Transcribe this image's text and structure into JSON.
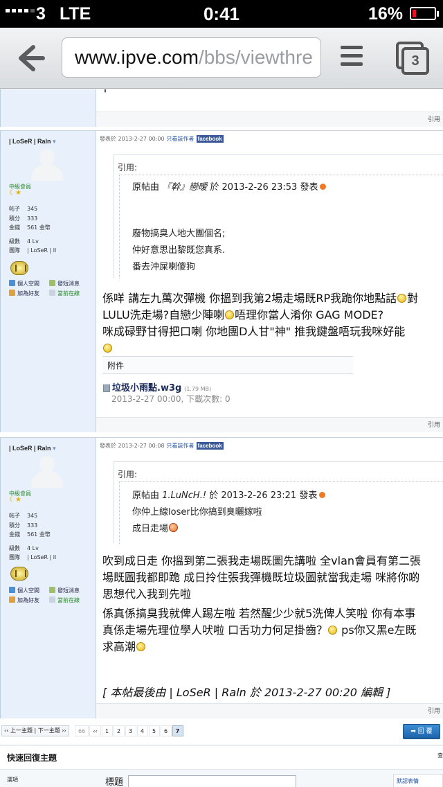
{
  "status_bar": {
    "carrier": "3",
    "network": "LTE",
    "time": "0:41",
    "battery_percent": "16%",
    "battery_level": 0.16
  },
  "browser": {
    "url_host": "www.ipve.com",
    "url_path": "/bbs/viewthre",
    "tab_count": "3",
    "back_icon": "back-arrow-icon",
    "menu_icon": "hamburger-menu-icon",
    "tabs_icon": "tabs-icon"
  },
  "top_post": {
    "quote_line": "┃",
    "reply_label": "引用"
  },
  "posts": [
    {
      "author": "| LoSeR | Raln",
      "group": "中級會員",
      "stats": [
        {
          "key": "帖子",
          "value": "345"
        },
        {
          "key": "積分",
          "value": "333"
        },
        {
          "key": "金錢",
          "value": "561 金幣"
        },
        {
          "key": "級數",
          "value": "4 Lv"
        },
        {
          "key": "團隊",
          "value": "| LoSeR | ll"
        }
      ],
      "links": {
        "space": "個人空間",
        "message": "發短消息",
        "add_friend": "加為好友",
        "online": "當前在線"
      },
      "posted_at": "發表於 2013-2-27 00:00",
      "only_author": "只看該作者",
      "facebook": "facebook",
      "quote": {
        "title": "引用:",
        "header_prefix": "原帖由",
        "quoted_author": "『幹』戀暧",
        "header_suffix": "於 2013-2-26 23:53 發表",
        "lines": [
          "廢物搞臭人地大團個名;",
          "仲好意思出黎既您真系.",
          "番去沖屎喇傻狗"
        ]
      },
      "body_lines": [
        "係咩  講左九萬次彈機 你搵到我第2場走場既RP我跪你地點話",
        "對",
        "LULU洗走場?自戀少陣喇",
        "唔理你當人淆你 GAG MODE?",
        "       咪成碌野甘得把口喇 你地團D人甘\"神\"   推我鍵盤唔玩我咪好能"
      ],
      "attachment": {
        "title": "附件",
        "name": "垃圾小雨點.w3g",
        "size": "(1.79 MB)",
        "meta": "2013-2-27 00:00, 下載次數: 0"
      },
      "reply_label": "引用"
    },
    {
      "author": "| LoSeR | Raln",
      "group": "中級會員",
      "stats": [
        {
          "key": "帖子",
          "value": "345"
        },
        {
          "key": "積分",
          "value": "333"
        },
        {
          "key": "金錢",
          "value": "561 金幣"
        },
        {
          "key": "級數",
          "value": "4 Lv"
        },
        {
          "key": "團隊",
          "value": "| LoSeR | ll"
        }
      ],
      "links": {
        "space": "個人空間",
        "message": "發短消息",
        "add_friend": "加為好友",
        "online": "當前在線"
      },
      "posted_at": "發表於 2013-2-27 00:08",
      "only_author": "只看該作者",
      "facebook": "facebook",
      "quote": {
        "title": "引用:",
        "header_prefix": "原帖由",
        "quoted_author": "1.LuNcH.!",
        "header_suffix": "於 2013-2-26 23:21 發表",
        "lines": [
          "你仲上線loser比你搞到臭曬嫁啦",
          "成日走場"
        ]
      },
      "body_lines": [
        "吹到成日走 你搵到第二張我走場既圖先講啦  全vlan會員有第二張",
        "場既圖我都即跪  成日拎住張我彈機既垃圾圖就當我走場  咪將你啲",
        "思想代入我到先啦",
        "係真係搞臭我就俾人踢左啦  若然醒少少就5洗俾人笑啦   你有本事",
        "真係走場先理位學人吠啦  口舌功力何足掛齒？",
        "  ps你又黑e左既",
        "求高潮"
      ],
      "edit_note": "[ 本帖最後由  | LoSeR | Raln 於 2013-2-27 00:20 編輯 ]",
      "reply_label": "引用"
    }
  ],
  "pagination": {
    "prev_next": "‹‹ 上一主題 | 下一主題 ››",
    "pages": [
      "66",
      "‹‹",
      "1",
      "2",
      "3",
      "4",
      "5",
      "6",
      "7"
    ],
    "current": "7",
    "return_label": "➡ 回 覆"
  },
  "quick_reply": {
    "title": "快速回復主題",
    "side_label": "查",
    "options_label": "選項",
    "subject_label": "標題",
    "subject_value": "",
    "emoji_label": "默認表情"
  }
}
